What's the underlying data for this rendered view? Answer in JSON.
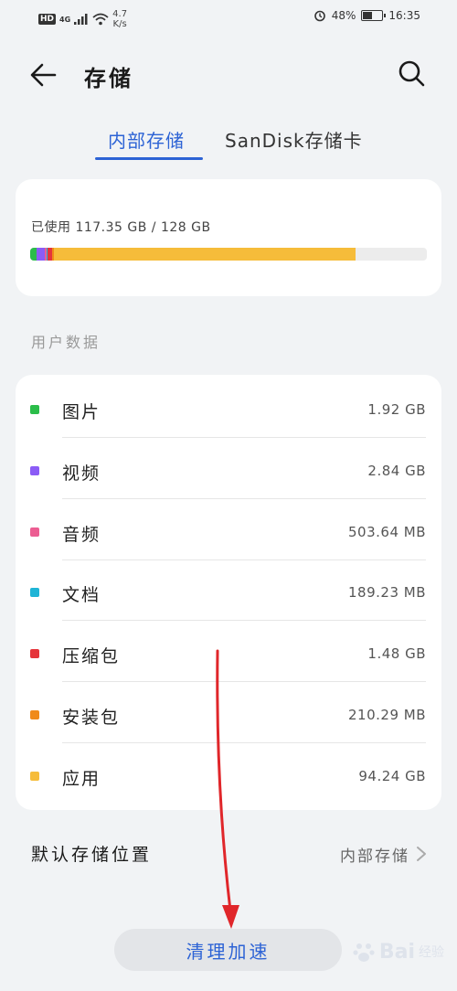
{
  "status_bar": {
    "hd_badge": "HD",
    "network": "4G",
    "speed_value": "4.7",
    "speed_unit": "K/s",
    "battery_percent": "48%",
    "battery_level": 0.48,
    "time": "16:35"
  },
  "header": {
    "title": "存储",
    "back_icon": "arrow-left-icon",
    "search_icon": "search-icon"
  },
  "tabs": [
    {
      "label": "内部存储",
      "active": true
    },
    {
      "label": "SanDisk存储卡",
      "active": false
    }
  ],
  "usage": {
    "text": "已使用 117.35 GB / 128 GB",
    "used_fraction": 0.917,
    "segments": [
      {
        "name": "图片",
        "fraction": 0.015,
        "color": "#2bbd4a"
      },
      {
        "name": "视频",
        "fraction": 0.022,
        "color": "#8b5cf6"
      },
      {
        "name": "音频",
        "fraction": 0.004,
        "color": "#ec5d92"
      },
      {
        "name": "文档",
        "fraction": 0.002,
        "color": "#1fb4d6"
      },
      {
        "name": "压缩包",
        "fraction": 0.012,
        "color": "#e5343a"
      },
      {
        "name": "安装包",
        "fraction": 0.006,
        "color": "#f08a1a"
      },
      {
        "name": "应用",
        "fraction": 0.759,
        "color": "#f6bc3a"
      }
    ]
  },
  "section_label": "用户数据",
  "user_data": [
    {
      "label": "图片",
      "value": "1.92 GB",
      "color": "#2bbd4a"
    },
    {
      "label": "视频",
      "value": "2.84 GB",
      "color": "#8b5cf6"
    },
    {
      "label": "音频",
      "value": "503.64 MB",
      "color": "#ec5d92"
    },
    {
      "label": "文档",
      "value": "189.23 MB",
      "color": "#1fb4d6"
    },
    {
      "label": "压缩包",
      "value": "1.48 GB",
      "color": "#e5343a"
    },
    {
      "label": "安装包",
      "value": "210.29 MB",
      "color": "#f08a1a"
    },
    {
      "label": "应用",
      "value": "94.24 GB",
      "color": "#f6bc3a"
    }
  ],
  "default_storage": {
    "label": "默认存储位置",
    "value": "内部存储"
  },
  "clean_button": "清理加速",
  "watermark": {
    "text": "Bai",
    "sub": "经验"
  },
  "colors": {
    "accent": "#2d63d5",
    "annotation": "#e0262a"
  }
}
